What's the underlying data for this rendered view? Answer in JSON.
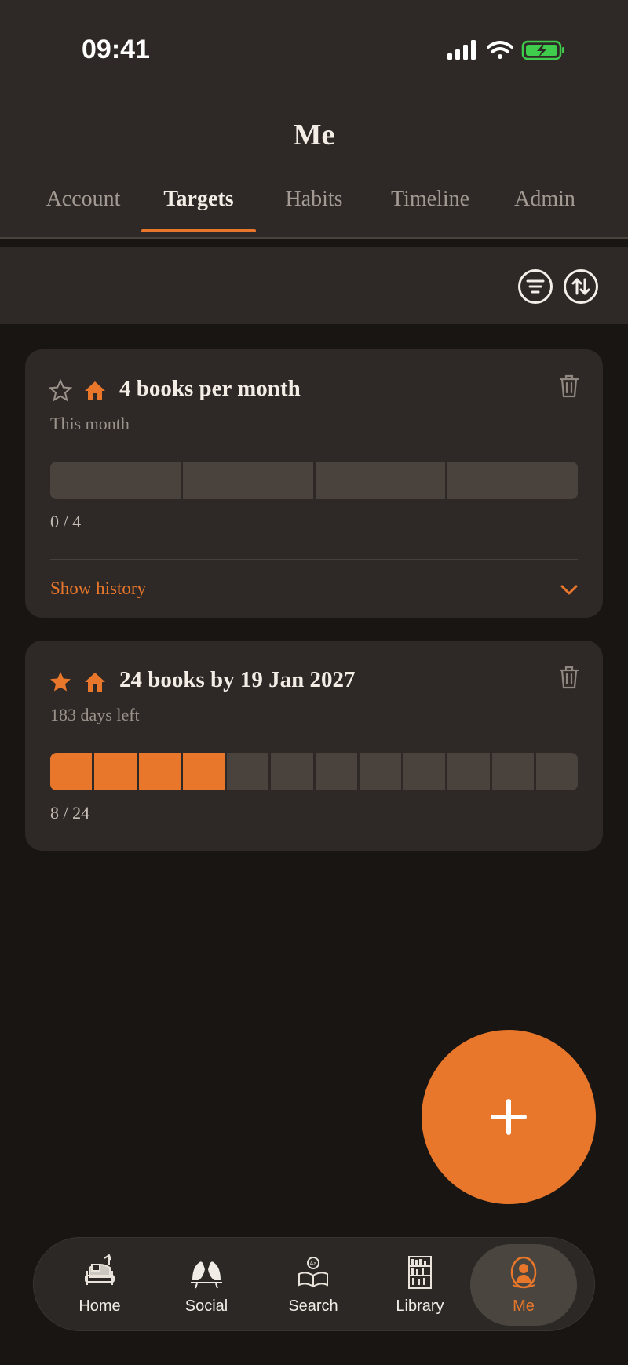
{
  "status_bar": {
    "time": "09:41",
    "icons": [
      "signal-icon",
      "wifi-icon",
      "battery-charging-icon"
    ],
    "battery_color": "#3fcb4b"
  },
  "header": {
    "title": "Me",
    "tabs": [
      {
        "label": "Account",
        "active": false
      },
      {
        "label": "Targets",
        "active": true
      },
      {
        "label": "Habits",
        "active": false
      },
      {
        "label": "Timeline",
        "active": false
      },
      {
        "label": "Admin",
        "active": false
      }
    ]
  },
  "toolbar": {
    "icons": [
      "filter-icon",
      "sort-icon"
    ]
  },
  "targets": [
    {
      "title": "4 books per month",
      "subtitle": "This month",
      "starred": false,
      "progress_text": "0 / 4",
      "current": 0,
      "total": 4,
      "history_label": "Show history"
    },
    {
      "title": "24 books by 19 Jan 2027",
      "subtitle": "183 days left",
      "starred": true,
      "progress_text": "8 / 24",
      "current": 8,
      "total": 24,
      "segments": 12,
      "filled_segments": 4
    }
  ],
  "fab": {
    "icon": "plus-icon"
  },
  "bottom_nav": [
    {
      "label": "Home",
      "icon": "armchair-reading-icon",
      "active": false
    },
    {
      "label": "Social",
      "icon": "birds-icon",
      "active": false
    },
    {
      "label": "Search",
      "icon": "open-book-search-icon",
      "active": false
    },
    {
      "label": "Library",
      "icon": "bookshelf-icon",
      "active": false
    },
    {
      "label": "Me",
      "icon": "portrait-icon",
      "active": true
    }
  ],
  "colors": {
    "accent": "#e8772b",
    "background": "#181513",
    "surface": "#2e2926",
    "progress_empty": "#4a433d"
  }
}
